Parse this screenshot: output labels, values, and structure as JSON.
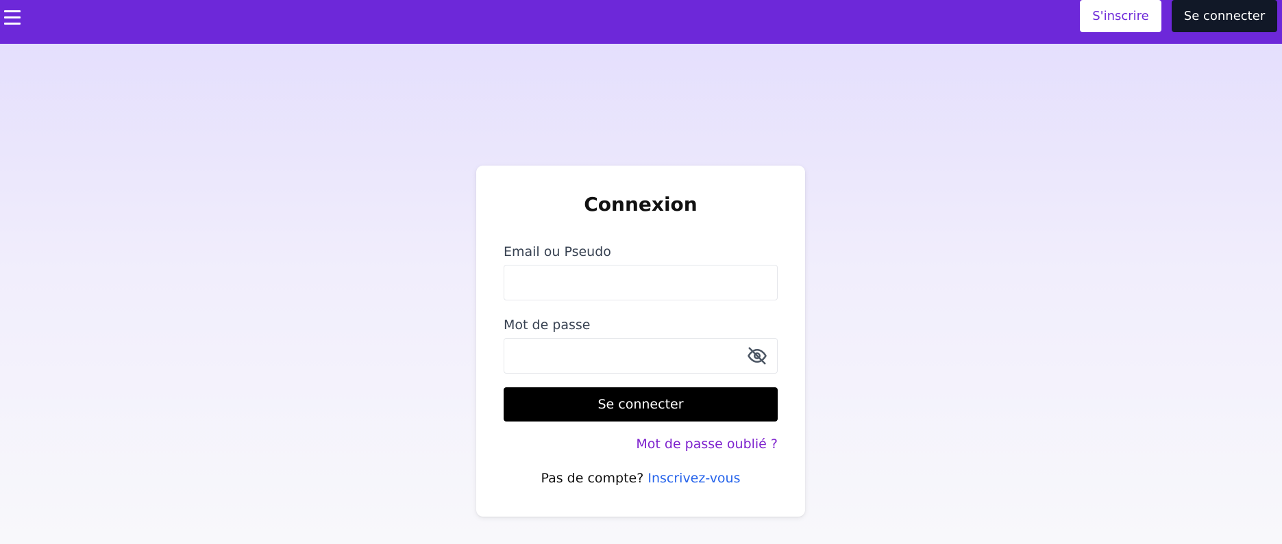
{
  "header": {
    "menu_icon": "hamburger-menu-icon",
    "signup_label": "S'inscrire",
    "login_label": "Se connecter",
    "bar_color": "#6d28d9"
  },
  "login_card": {
    "title": "Connexion",
    "identifier_label": "Email ou Pseudo",
    "identifier_value": "",
    "password_label": "Mot de passe",
    "password_value": "",
    "password_toggle_icon": "eye-slash-icon",
    "submit_label": "Se connecter",
    "forgot_password_label": "Mot de passe oublié ?",
    "no_account_text": "Pas de compte?",
    "register_link": "Inscrivez-vous"
  }
}
